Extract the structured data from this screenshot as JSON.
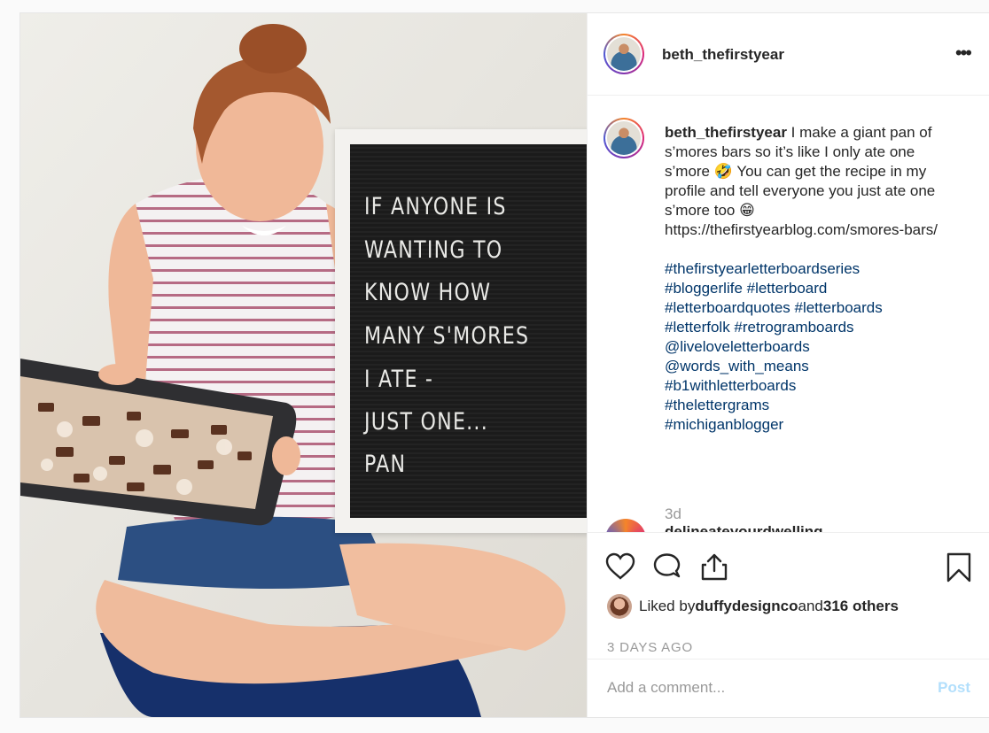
{
  "photo": {
    "letterboard_lines": [
      "IF ANYONE IS",
      "WANTING TO",
      "KNOW HOW",
      "MANY S'MORES",
      "I ATE -",
      "JUST ONE...",
      "PAN"
    ]
  },
  "header": {
    "username": "beth_thefirstyear",
    "more_label": "•••"
  },
  "caption": {
    "username": "beth_thefirstyear",
    "text": " I make a giant pan of s’mores bars so it’s like I only ate one s’more 🤣 You can get the recipe in my profile and tell everyone you just ate one s’more too 😁 https://thefirstyearblog.com/smores-bars/",
    "hashtags": [
      "#thefirstyearletterboardseries",
      "#bloggerlife #letterboard",
      "#letterboardquotes #letterboards",
      "#letterfolk #retrogramboards",
      "@liveloveletterboards",
      "@words_with_means",
      "#b1withletterboards",
      "#theletter​grams",
      "#michiganblogger"
    ],
    "age": "3d"
  },
  "next_comment": {
    "username": "delineateyourdwelling"
  },
  "actions": {
    "icons": [
      "heart-icon",
      "comment-icon",
      "share-icon",
      "bookmark-icon"
    ]
  },
  "likes": {
    "prefix": "Liked by ",
    "first_user": "duffydesignco",
    "conjunction": " and ",
    "others": "316 others"
  },
  "timestamp": "3 DAYS AGO",
  "comment_box": {
    "placeholder": "Add a comment...",
    "post_label": "Post"
  },
  "colors": {
    "hashtag": "#003569",
    "muted": "#999999",
    "post_disabled": "#b2dffc",
    "text": "#262626"
  }
}
